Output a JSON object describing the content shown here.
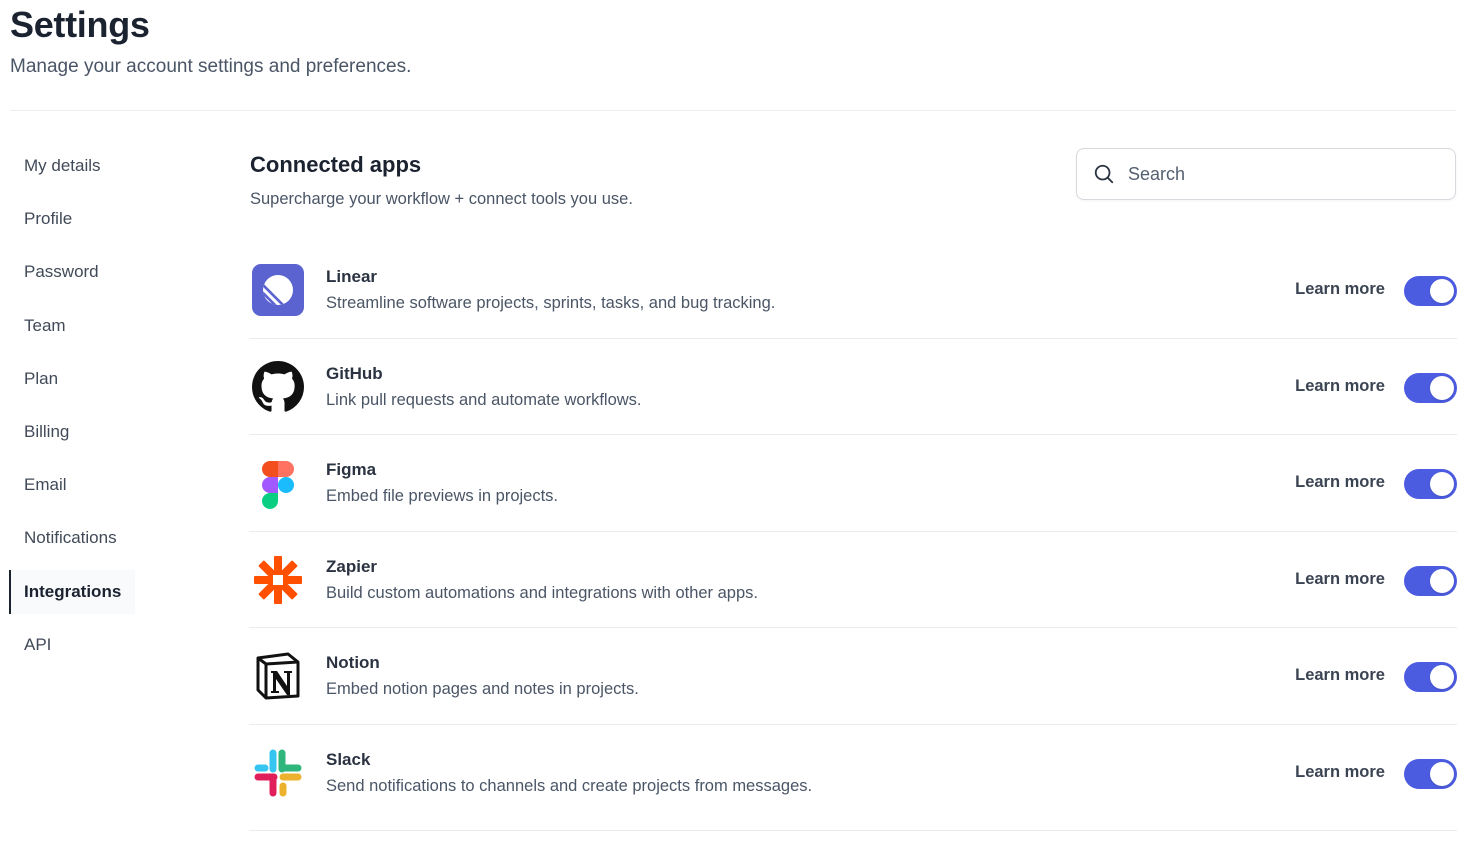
{
  "header": {
    "title": "Settings",
    "subtitle": "Manage your account settings and preferences."
  },
  "sidebar": {
    "items": [
      {
        "label": "My details",
        "active": false
      },
      {
        "label": "Profile",
        "active": false
      },
      {
        "label": "Password",
        "active": false
      },
      {
        "label": "Team",
        "active": false
      },
      {
        "label": "Plan",
        "active": false
      },
      {
        "label": "Billing",
        "active": false
      },
      {
        "label": "Email",
        "active": false
      },
      {
        "label": "Notifications",
        "active": false
      },
      {
        "label": "Integrations",
        "active": true
      },
      {
        "label": "API",
        "active": false
      }
    ]
  },
  "main": {
    "title": "Connected apps",
    "subtitle": "Supercharge your workflow + connect tools you use.",
    "search": {
      "placeholder": "Search",
      "value": ""
    },
    "learn_more_label": "Learn more",
    "apps": [
      {
        "name": "Linear",
        "description": "Streamline software projects, sprints, tasks, and bug tracking.",
        "icon": "linear-icon",
        "enabled": true
      },
      {
        "name": "GitHub",
        "description": "Link pull requests and automate workflows.",
        "icon": "github-icon",
        "enabled": true
      },
      {
        "name": "Figma",
        "description": "Embed file previews in projects.",
        "icon": "figma-icon",
        "enabled": true
      },
      {
        "name": "Zapier",
        "description": "Build custom automations and integrations with other apps.",
        "icon": "zapier-icon",
        "enabled": true
      },
      {
        "name": "Notion",
        "description": "Embed notion pages and notes in projects.",
        "icon": "notion-icon",
        "enabled": true
      },
      {
        "name": "Slack",
        "description": "Send notifications to channels and create projects from messages.",
        "icon": "slack-icon",
        "enabled": true
      }
    ]
  },
  "colors": {
    "toggle_on": "#4c5ce0",
    "active_nav_bar": "#1b2230"
  }
}
